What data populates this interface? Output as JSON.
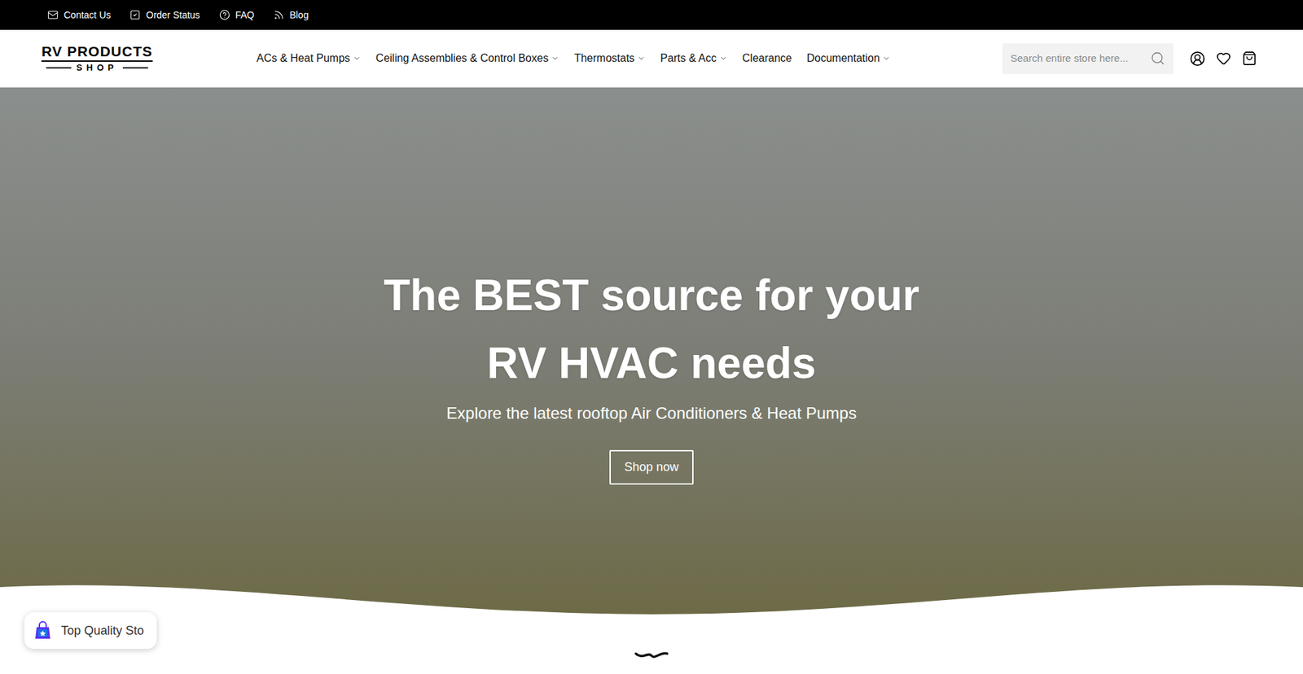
{
  "top_bar": {
    "links": [
      {
        "label": "Contact Us",
        "icon": "mail"
      },
      {
        "label": "Order Status",
        "icon": "check"
      },
      {
        "label": "FAQ",
        "icon": "help"
      },
      {
        "label": "Blog",
        "icon": "blog"
      }
    ]
  },
  "logo": {
    "line1": "RV PRODUCTS",
    "line2": "SHOP"
  },
  "nav": [
    {
      "label": "ACs & Heat Pumps",
      "dropdown": true
    },
    {
      "label": "Ceiling Assemblies & Control Boxes",
      "dropdown": true
    },
    {
      "label": "Thermostats",
      "dropdown": true
    },
    {
      "label": "Parts & Acc",
      "dropdown": true
    },
    {
      "label": "Clearance",
      "dropdown": false
    },
    {
      "label": "Documentation",
      "dropdown": true
    }
  ],
  "search": {
    "placeholder": "Search entire store here..."
  },
  "hero": {
    "title_line1": "The BEST source for your",
    "title_line2": "RV HVAC needs",
    "subtitle": "Explore the latest rooftop Air Conditioners & Heat Pumps",
    "button": "Shop now"
  },
  "badge": {
    "label": "Top Quality Sto"
  }
}
